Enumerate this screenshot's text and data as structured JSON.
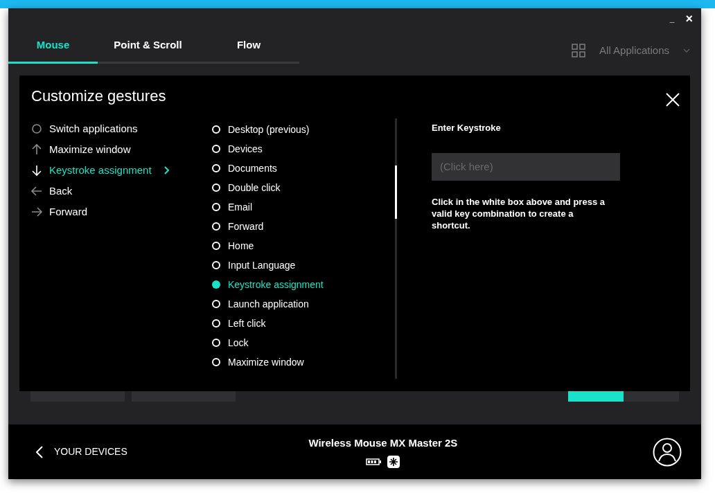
{
  "window": {
    "minimize": "_",
    "close": "×"
  },
  "tabs": [
    {
      "label": "Mouse",
      "selected": true
    },
    {
      "label": "Point & Scroll",
      "selected": false
    },
    {
      "label": "Flow",
      "selected": false
    }
  ],
  "app_selector": {
    "label": "All Applications"
  },
  "dialog": {
    "title": "Customize gestures",
    "gestures": [
      {
        "kind": "circle",
        "label": "Switch applications",
        "selected": false
      },
      {
        "kind": "up",
        "label": "Maximize window",
        "selected": false
      },
      {
        "kind": "down",
        "label": "Keystroke assignment",
        "selected": true
      },
      {
        "kind": "left",
        "label": "Back",
        "selected": false
      },
      {
        "kind": "right",
        "label": "Forward",
        "selected": false
      }
    ],
    "actions": [
      {
        "label": "Desktop (previous)",
        "selected": false
      },
      {
        "label": "Devices",
        "selected": false
      },
      {
        "label": "Documents",
        "selected": false
      },
      {
        "label": "Double click",
        "selected": false
      },
      {
        "label": "Email",
        "selected": false
      },
      {
        "label": "Forward",
        "selected": false
      },
      {
        "label": "Home",
        "selected": false
      },
      {
        "label": "Input Language",
        "selected": false
      },
      {
        "label": "Keystroke assignment",
        "selected": true
      },
      {
        "label": "Launch application",
        "selected": false
      },
      {
        "label": "Left click",
        "selected": false
      },
      {
        "label": "Lock",
        "selected": false
      },
      {
        "label": "Maximize window",
        "selected": false
      }
    ],
    "keystroke": {
      "heading": "Enter Keystroke",
      "placeholder": "(Click here)",
      "help": "Click in the white box above and press a valid key combination to create a shortcut."
    }
  },
  "footer": {
    "back_label": "YOUR DEVICES",
    "device_name": "Wireless Mouse MX Master 2S"
  }
}
